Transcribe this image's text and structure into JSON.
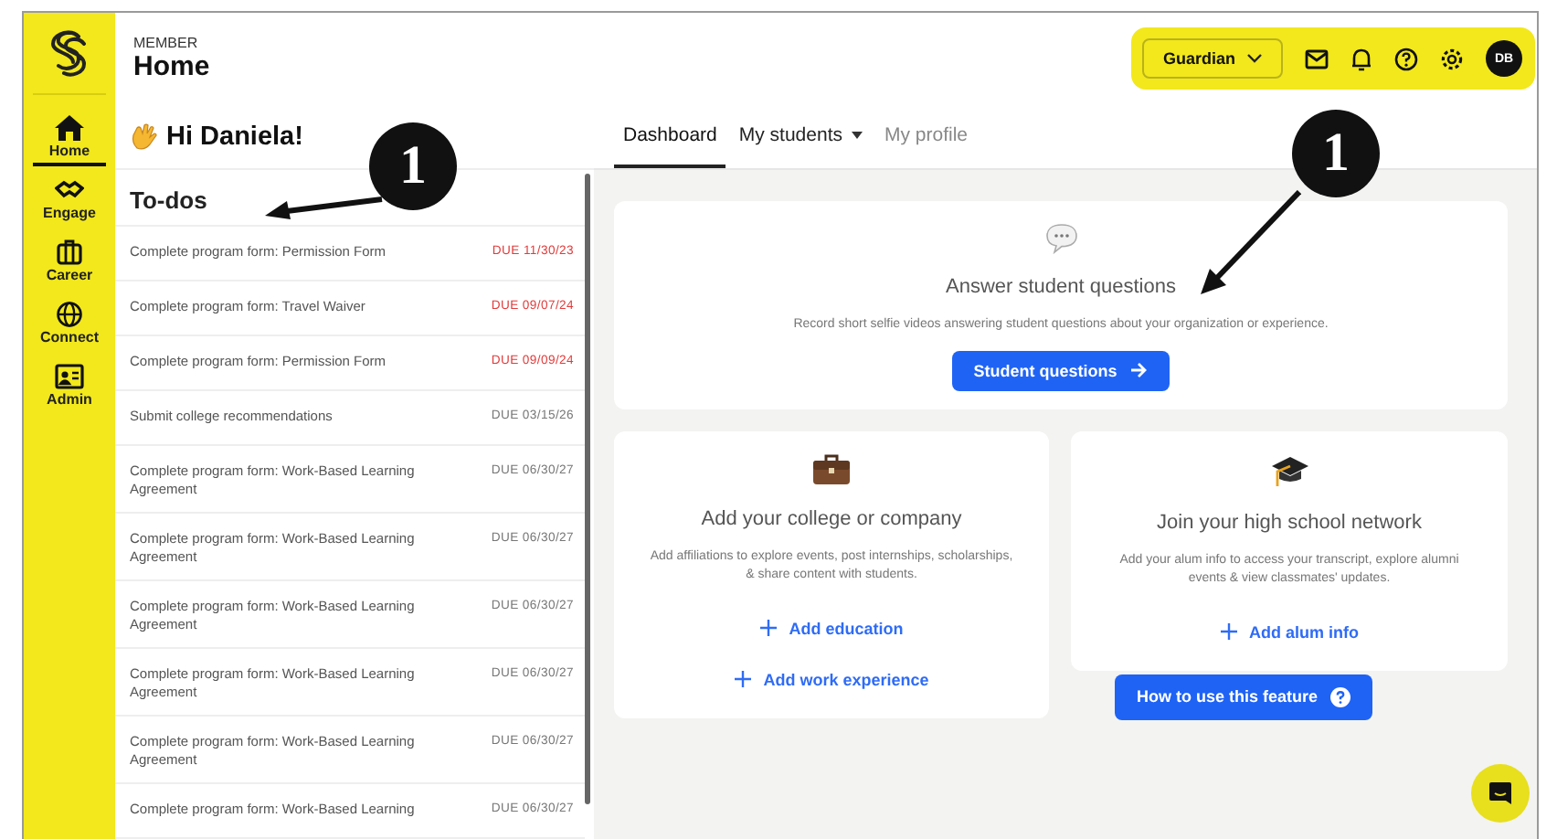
{
  "nav": {
    "items": [
      {
        "label": "Home",
        "selected": true
      },
      {
        "label": "Engage",
        "selected": false
      },
      {
        "label": "Career",
        "selected": false
      },
      {
        "label": "Connect",
        "selected": false
      },
      {
        "label": "Admin",
        "selected": false
      }
    ]
  },
  "header": {
    "eyebrow": "MEMBER",
    "title": "Home"
  },
  "toolbar": {
    "role_dropdown": "Guardian",
    "avatar_initials": "DB",
    "highlighted": true
  },
  "greeting": "Hi Daniela!",
  "todos": {
    "title": "To-dos",
    "items": [
      {
        "text": "Complete program form: Permission Form",
        "due": "DUE 11/30/23",
        "overdue": true
      },
      {
        "text": "Complete program form: Travel Waiver",
        "due": "DUE 09/07/24",
        "overdue": true
      },
      {
        "text": "Complete program form: Permission Form",
        "due": "DUE 09/09/24",
        "overdue": true
      },
      {
        "text": "Submit college recommendations",
        "due": "DUE 03/15/26",
        "overdue": false
      },
      {
        "text": "Complete program form: Work-Based Learning Agreement",
        "due": "DUE 06/30/27",
        "overdue": false
      },
      {
        "text": "Complete program form: Work-Based Learning Agreement",
        "due": "DUE 06/30/27",
        "overdue": false
      },
      {
        "text": "Complete program form: Work-Based Learning Agreement",
        "due": "DUE 06/30/27",
        "overdue": false
      },
      {
        "text": "Complete program form: Work-Based Learning Agreement",
        "due": "DUE 06/30/27",
        "overdue": false
      },
      {
        "text": "Complete program form: Work-Based Learning Agreement",
        "due": "DUE 06/30/27",
        "overdue": false
      },
      {
        "text": "Complete program form: Work-Based Learning",
        "due": "DUE 06/30/27",
        "overdue": false
      }
    ]
  },
  "tabs": [
    {
      "label": "Dashboard",
      "selected": true,
      "kind": "plain"
    },
    {
      "label": "My students",
      "selected": false,
      "kind": "menu"
    },
    {
      "label": "My profile",
      "selected": false,
      "kind": "plain"
    }
  ],
  "cards": [
    {
      "title": "Answer student questions",
      "text": "Record short selfie videos answering student questions about your organization or experience.",
      "actions": [
        {
          "kind": "primary",
          "label": "Student questions"
        }
      ]
    },
    {
      "title": "Add your college or company",
      "text": "Add affiliations to explore events, post internships, scholarships, & share content with students.",
      "actions": [
        {
          "kind": "add",
          "label": "Add education"
        },
        {
          "kind": "add",
          "label": "Add work experience"
        }
      ]
    },
    {
      "title": "Join your high school network",
      "text": "Add your alum info to access your transcript, explore alumni events & view classmates' updates.",
      "actions": [
        {
          "kind": "add",
          "label": "Add alum info"
        }
      ]
    }
  ],
  "help_button": "How to use this feature",
  "callouts": [
    {
      "number": "1"
    },
    {
      "number": "1"
    }
  ]
}
